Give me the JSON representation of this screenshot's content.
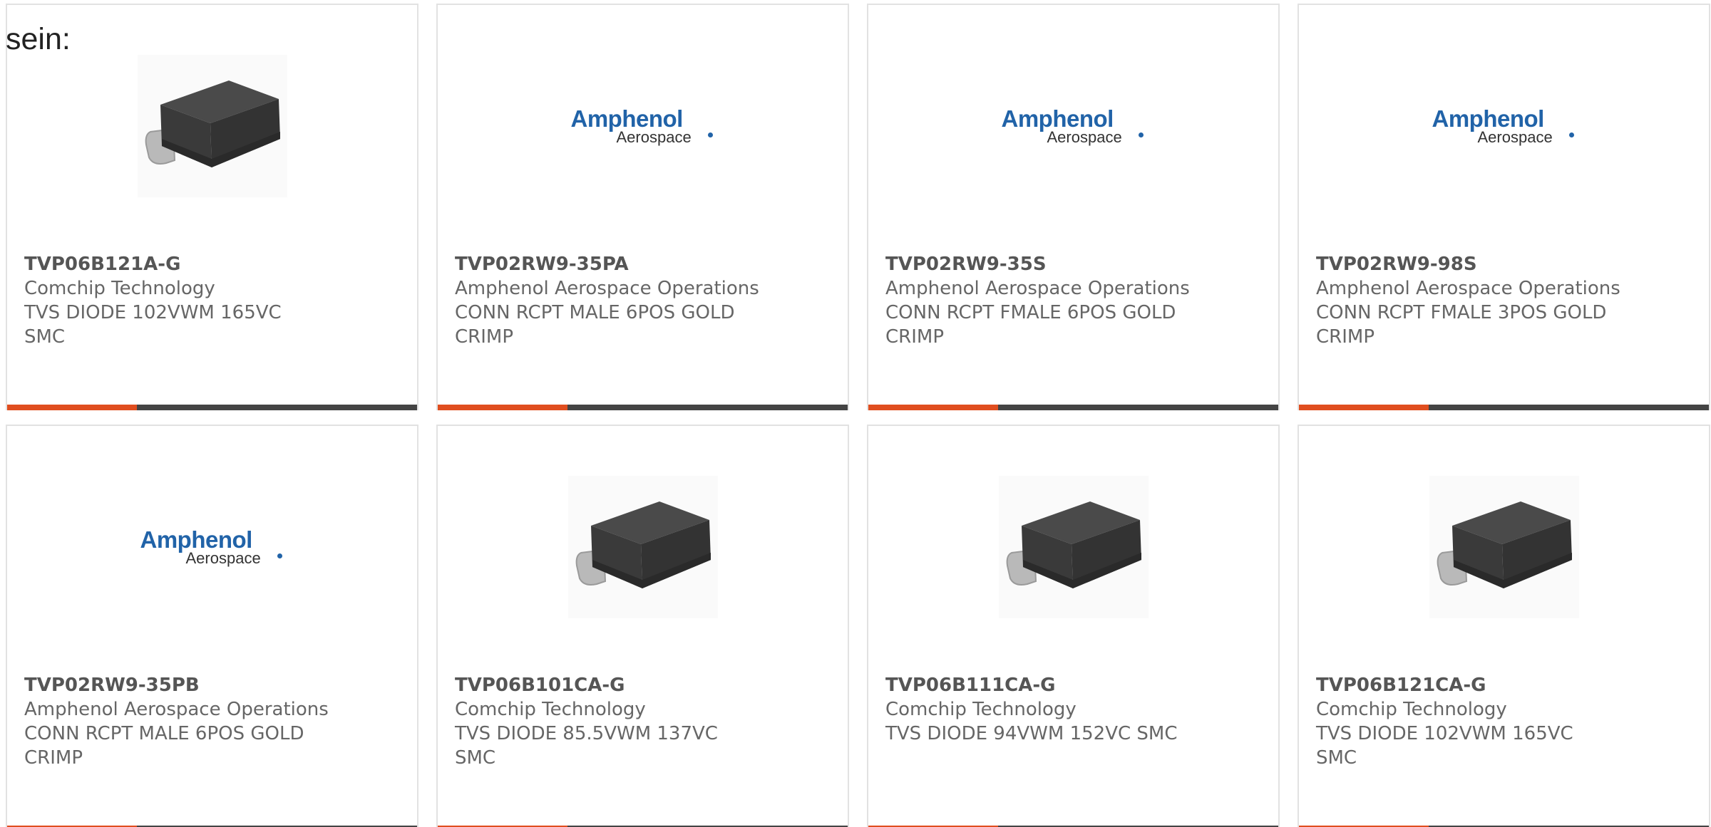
{
  "intro_text": "sein:",
  "colors": {
    "accent": "#e04e1f",
    "bar_dark": "#444444",
    "amphenol_blue": "#2163a8",
    "component_body": "#3a3a3a"
  },
  "logo": {
    "brand": "Amphenol",
    "sub": "Aerospace"
  },
  "products": [
    {
      "part_number": "TVP06B121A-G",
      "manufacturer": "Comchip Technology",
      "description": "TVS DIODE 102VWM 165VC SMC",
      "image": "smc-diode-icon"
    },
    {
      "part_number": "TVP02RW9-35PA",
      "manufacturer": "Amphenol Aerospace Operations",
      "description": "CONN RCPT MALE 6POS GOLD CRIMP",
      "image": "amphenol-logo"
    },
    {
      "part_number": "TVP02RW9-35S",
      "manufacturer": "Amphenol Aerospace Operations",
      "description": "CONN RCPT FMALE 6POS GOLD CRIMP",
      "image": "amphenol-logo"
    },
    {
      "part_number": "TVP02RW9-98S",
      "manufacturer": "Amphenol Aerospace Operations",
      "description": "CONN RCPT FMALE 3POS GOLD CRIMP",
      "image": "amphenol-logo"
    },
    {
      "part_number": "TVP02RW9-35PB",
      "manufacturer": "Amphenol Aerospace Operations",
      "description": "CONN RCPT MALE 6POS GOLD CRIMP",
      "image": "amphenol-logo"
    },
    {
      "part_number": "TVP06B101CA-G",
      "manufacturer": "Comchip Technology",
      "description": "TVS DIODE 85.5VWM 137VC SMC",
      "image": "smc-diode-icon"
    },
    {
      "part_number": "TVP06B111CA-G",
      "manufacturer": "Comchip Technology",
      "description": "TVS DIODE 94VWM 152VC SMC",
      "image": "smc-diode-icon"
    },
    {
      "part_number": "TVP06B121CA-G",
      "manufacturer": "Comchip Technology",
      "description": "TVS DIODE 102VWM 165VC SMC",
      "image": "smc-diode-icon"
    }
  ]
}
